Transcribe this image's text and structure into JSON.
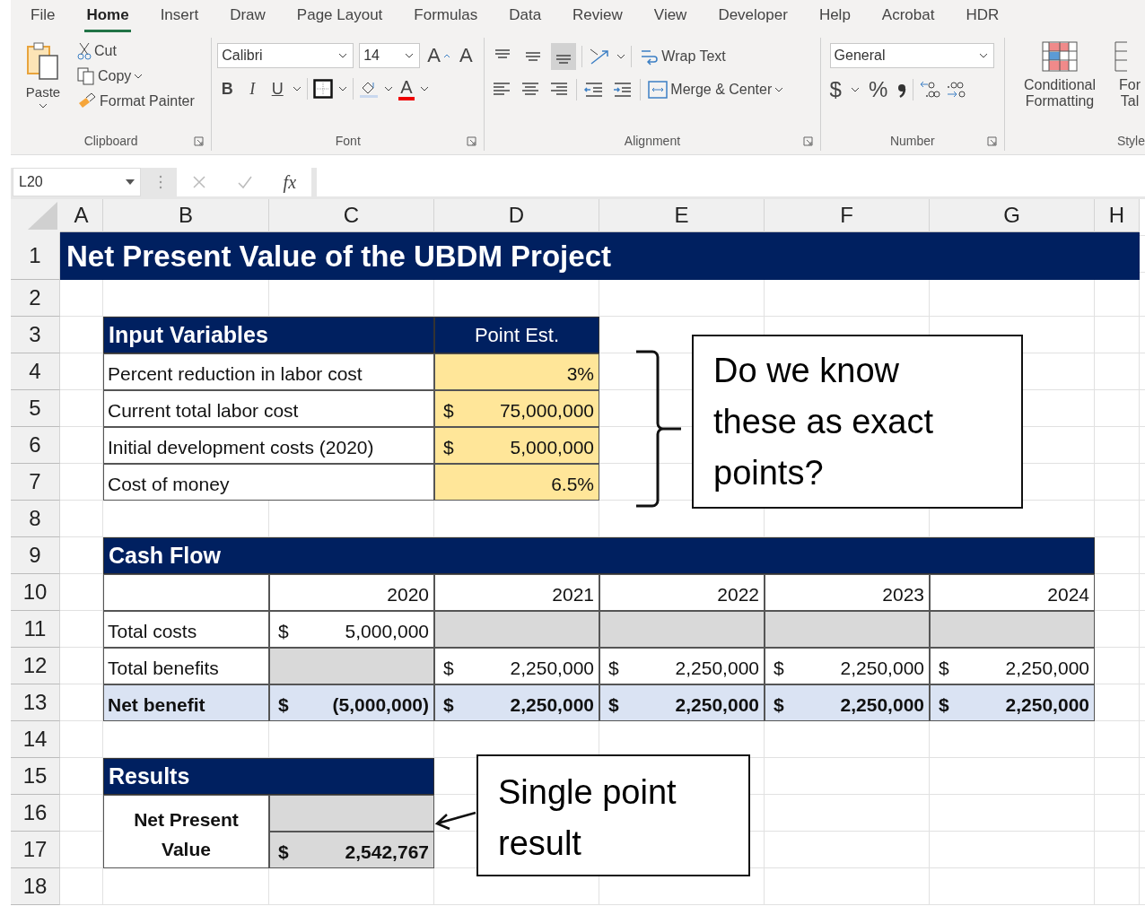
{
  "tabs": [
    {
      "label": "File",
      "selected": false
    },
    {
      "label": "Home",
      "selected": true
    },
    {
      "label": "Insert",
      "selected": false
    },
    {
      "label": "Draw",
      "selected": false
    },
    {
      "label": "Page Layout",
      "selected": false
    },
    {
      "label": "Formulas",
      "selected": false
    },
    {
      "label": "Data",
      "selected": false
    },
    {
      "label": "Review",
      "selected": false
    },
    {
      "label": "View",
      "selected": false
    },
    {
      "label": "Developer",
      "selected": false
    },
    {
      "label": "Help",
      "selected": false
    },
    {
      "label": "Acrobat",
      "selected": false
    },
    {
      "label": "HDR",
      "selected": false
    }
  ],
  "ribbon": {
    "clipboard": {
      "paste": "Paste",
      "cut": "Cut",
      "copy": "Copy",
      "format_painter": "Format Painter",
      "label": "Clipboard"
    },
    "font": {
      "family": "Calibri",
      "size": "14",
      "grow": "A",
      "shrink": "A",
      "bold": "B",
      "italic": "I",
      "underline": "U",
      "color_letter": "A",
      "label": "Font"
    },
    "alignment": {
      "vertical_align": [
        {
          "selected": false
        },
        {
          "selected": false
        },
        {
          "selected": true
        }
      ],
      "wrap_text": "Wrap Text",
      "merge_center": "Merge & Center",
      "label": "Alignment"
    },
    "number": {
      "format": "General",
      "currency": "$",
      "percent": "%",
      "label": "Number"
    },
    "styles": {
      "conditional_formatting": "Conditional Formatting",
      "format_table": "For Tal",
      "label": "Style"
    }
  },
  "formula_bar": {
    "name_box": "L20",
    "fx": "fx"
  },
  "sheet": {
    "columns": [
      "A",
      "B",
      "C",
      "D",
      "E",
      "F",
      "G",
      "H"
    ],
    "rows": [
      "1",
      "2",
      "3",
      "4",
      "5",
      "6",
      "7",
      "8",
      "9",
      "10",
      "11",
      "12",
      "13",
      "14",
      "15",
      "16",
      "17",
      "18"
    ],
    "title": "Net Present Value of the UBDM Project",
    "input_variables": {
      "title": "Input Variables",
      "column": "Point Est.",
      "items": [
        {
          "label": "Percent reduction in labor cost",
          "value": "3%"
        },
        {
          "label": "Current total labor cost",
          "currency": "$",
          "value": "75,000,000"
        },
        {
          "label": "Initial development costs (2020)",
          "currency": "$",
          "value": "5,000,000"
        },
        {
          "label": "Cost of money",
          "value": "6.5%"
        }
      ]
    },
    "cash_flow": {
      "title": "Cash Flow",
      "years": [
        "2020",
        "2021",
        "2022",
        "2023",
        "2024"
      ],
      "rows": [
        {
          "label": "Total costs",
          "kind": "line",
          "values": [
            {
              "shaded": false,
              "currency": "$",
              "value": "5,000,000"
            },
            {
              "shaded": true
            },
            {
              "shaded": true
            },
            {
              "shaded": true
            },
            {
              "shaded": true
            }
          ]
        },
        {
          "label": "Total benefits",
          "kind": "line",
          "values": [
            {
              "shaded": true
            },
            {
              "shaded": false,
              "currency": "$",
              "value": "2,250,000"
            },
            {
              "shaded": false,
              "currency": "$",
              "value": "2,250,000"
            },
            {
              "shaded": false,
              "currency": "$",
              "value": "2,250,000"
            },
            {
              "shaded": false,
              "currency": "$",
              "value": "2,250,000"
            }
          ]
        },
        {
          "label": "Net benefit",
          "kind": "total",
          "values": [
            {
              "shaded": false,
              "currency": "$",
              "value": "(5,000,000)"
            },
            {
              "shaded": false,
              "currency": "$",
              "value": "2,250,000"
            },
            {
              "shaded": false,
              "currency": "$",
              "value": "2,250,000"
            },
            {
              "shaded": false,
              "currency": "$",
              "value": "2,250,000"
            },
            {
              "shaded": false,
              "currency": "$",
              "value": "2,250,000"
            }
          ]
        }
      ]
    },
    "results": {
      "title": "Results",
      "label": "Net Present Value",
      "currency": "$",
      "value": "2,542,767"
    },
    "callouts": [
      {
        "text": "Do we know these as exact points?",
        "kind": "brace"
      },
      {
        "text": "Single point result",
        "kind": "arrow"
      }
    ]
  }
}
